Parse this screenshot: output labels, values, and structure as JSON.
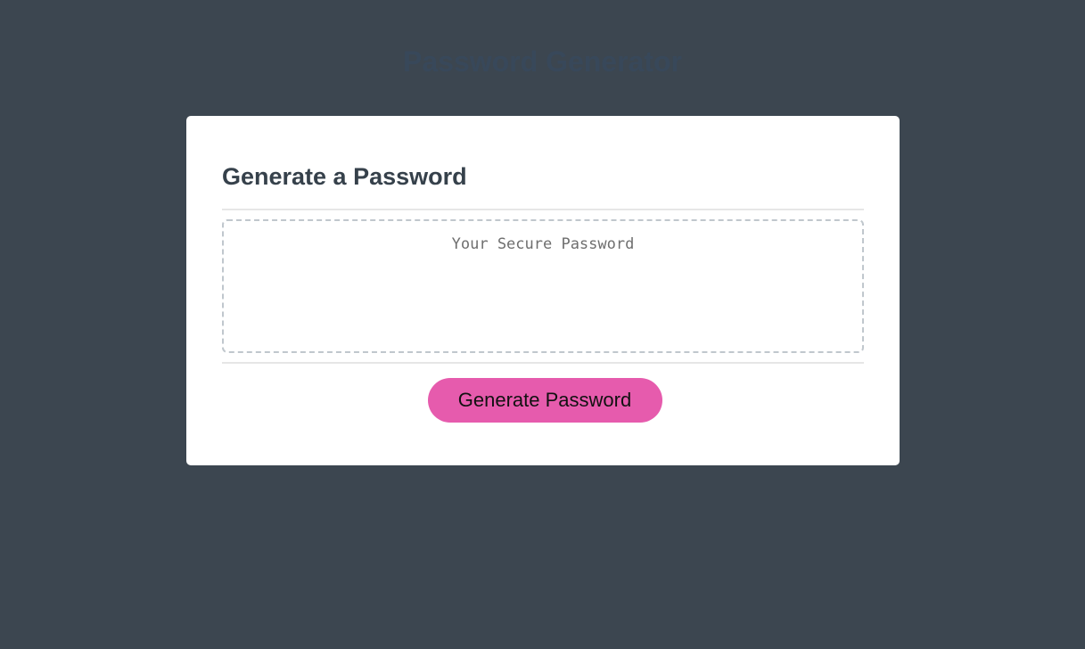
{
  "page": {
    "title": "Password Generator"
  },
  "card": {
    "title": "Generate a Password",
    "password": {
      "value": "",
      "placeholder": "Your Secure Password"
    },
    "generate_button_label": "Generate Password"
  },
  "colors": {
    "background": "#3c4650",
    "header_text": "#38485a",
    "card_background": "#ffffff",
    "card_title": "#36414b",
    "button": "#e65bad"
  }
}
